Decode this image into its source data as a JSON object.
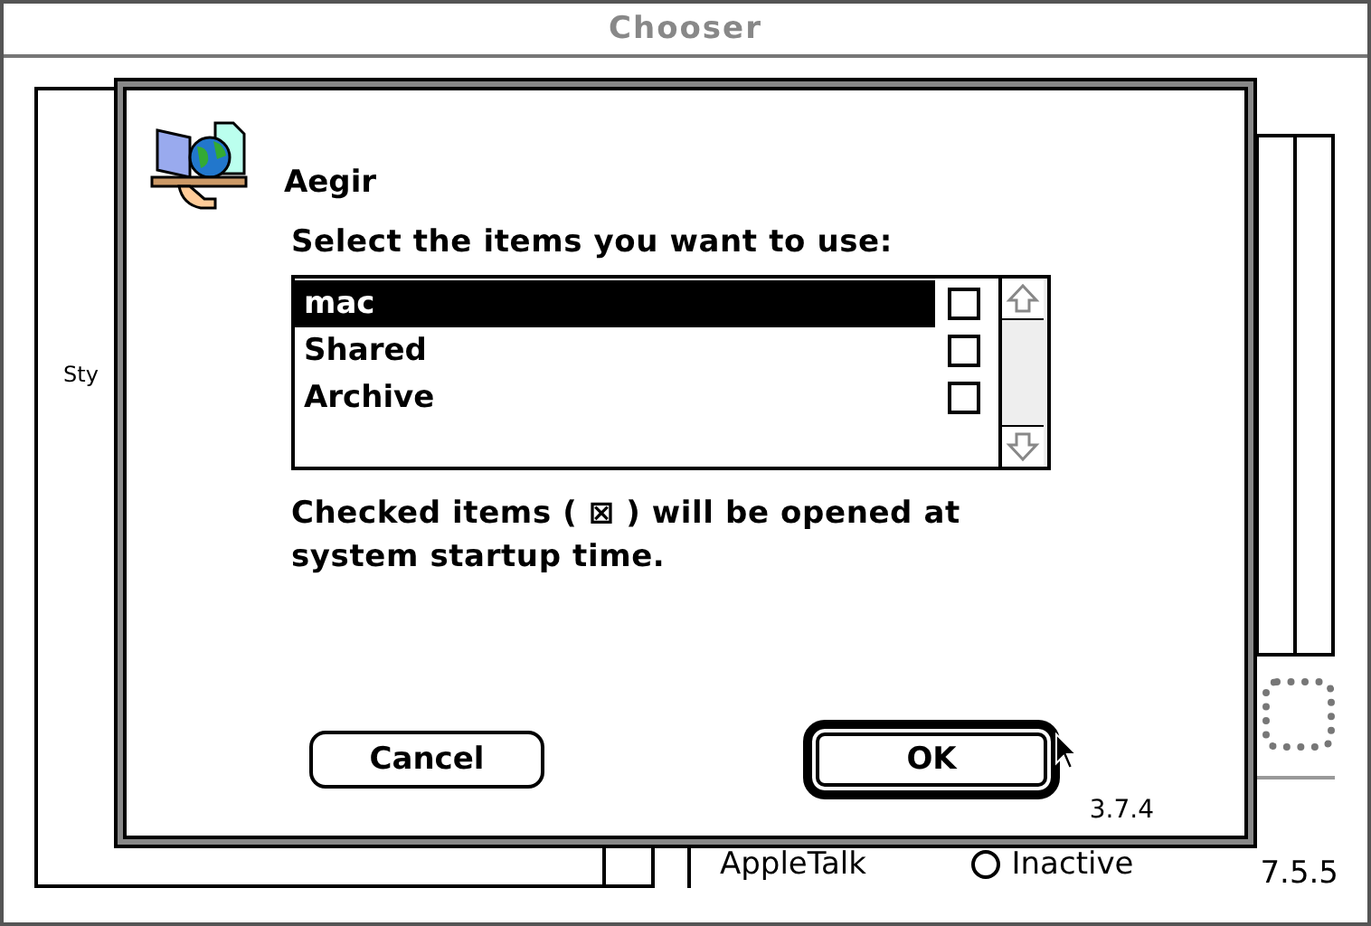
{
  "window": {
    "title": "Chooser"
  },
  "background": {
    "side_label": "Sty",
    "protocol_label": "AppleTalk",
    "radio": {
      "label": "Inactive",
      "selected": false
    },
    "version": "7.5.5"
  },
  "dialog": {
    "title": "Aegir",
    "prompt": "Select the items you want to use:",
    "items": [
      {
        "name": "mac",
        "selected": true,
        "checked": false
      },
      {
        "name": "Shared",
        "selected": false,
        "checked": false
      },
      {
        "name": "Archive",
        "selected": false,
        "checked": false
      }
    ],
    "note": "Checked items ( ⊠ ) will be opened at system startup time.",
    "buttons": [
      {
        "label": "Cancel",
        "default": false
      },
      {
        "label": "OK",
        "default": true
      }
    ],
    "version": "3.7.4"
  }
}
